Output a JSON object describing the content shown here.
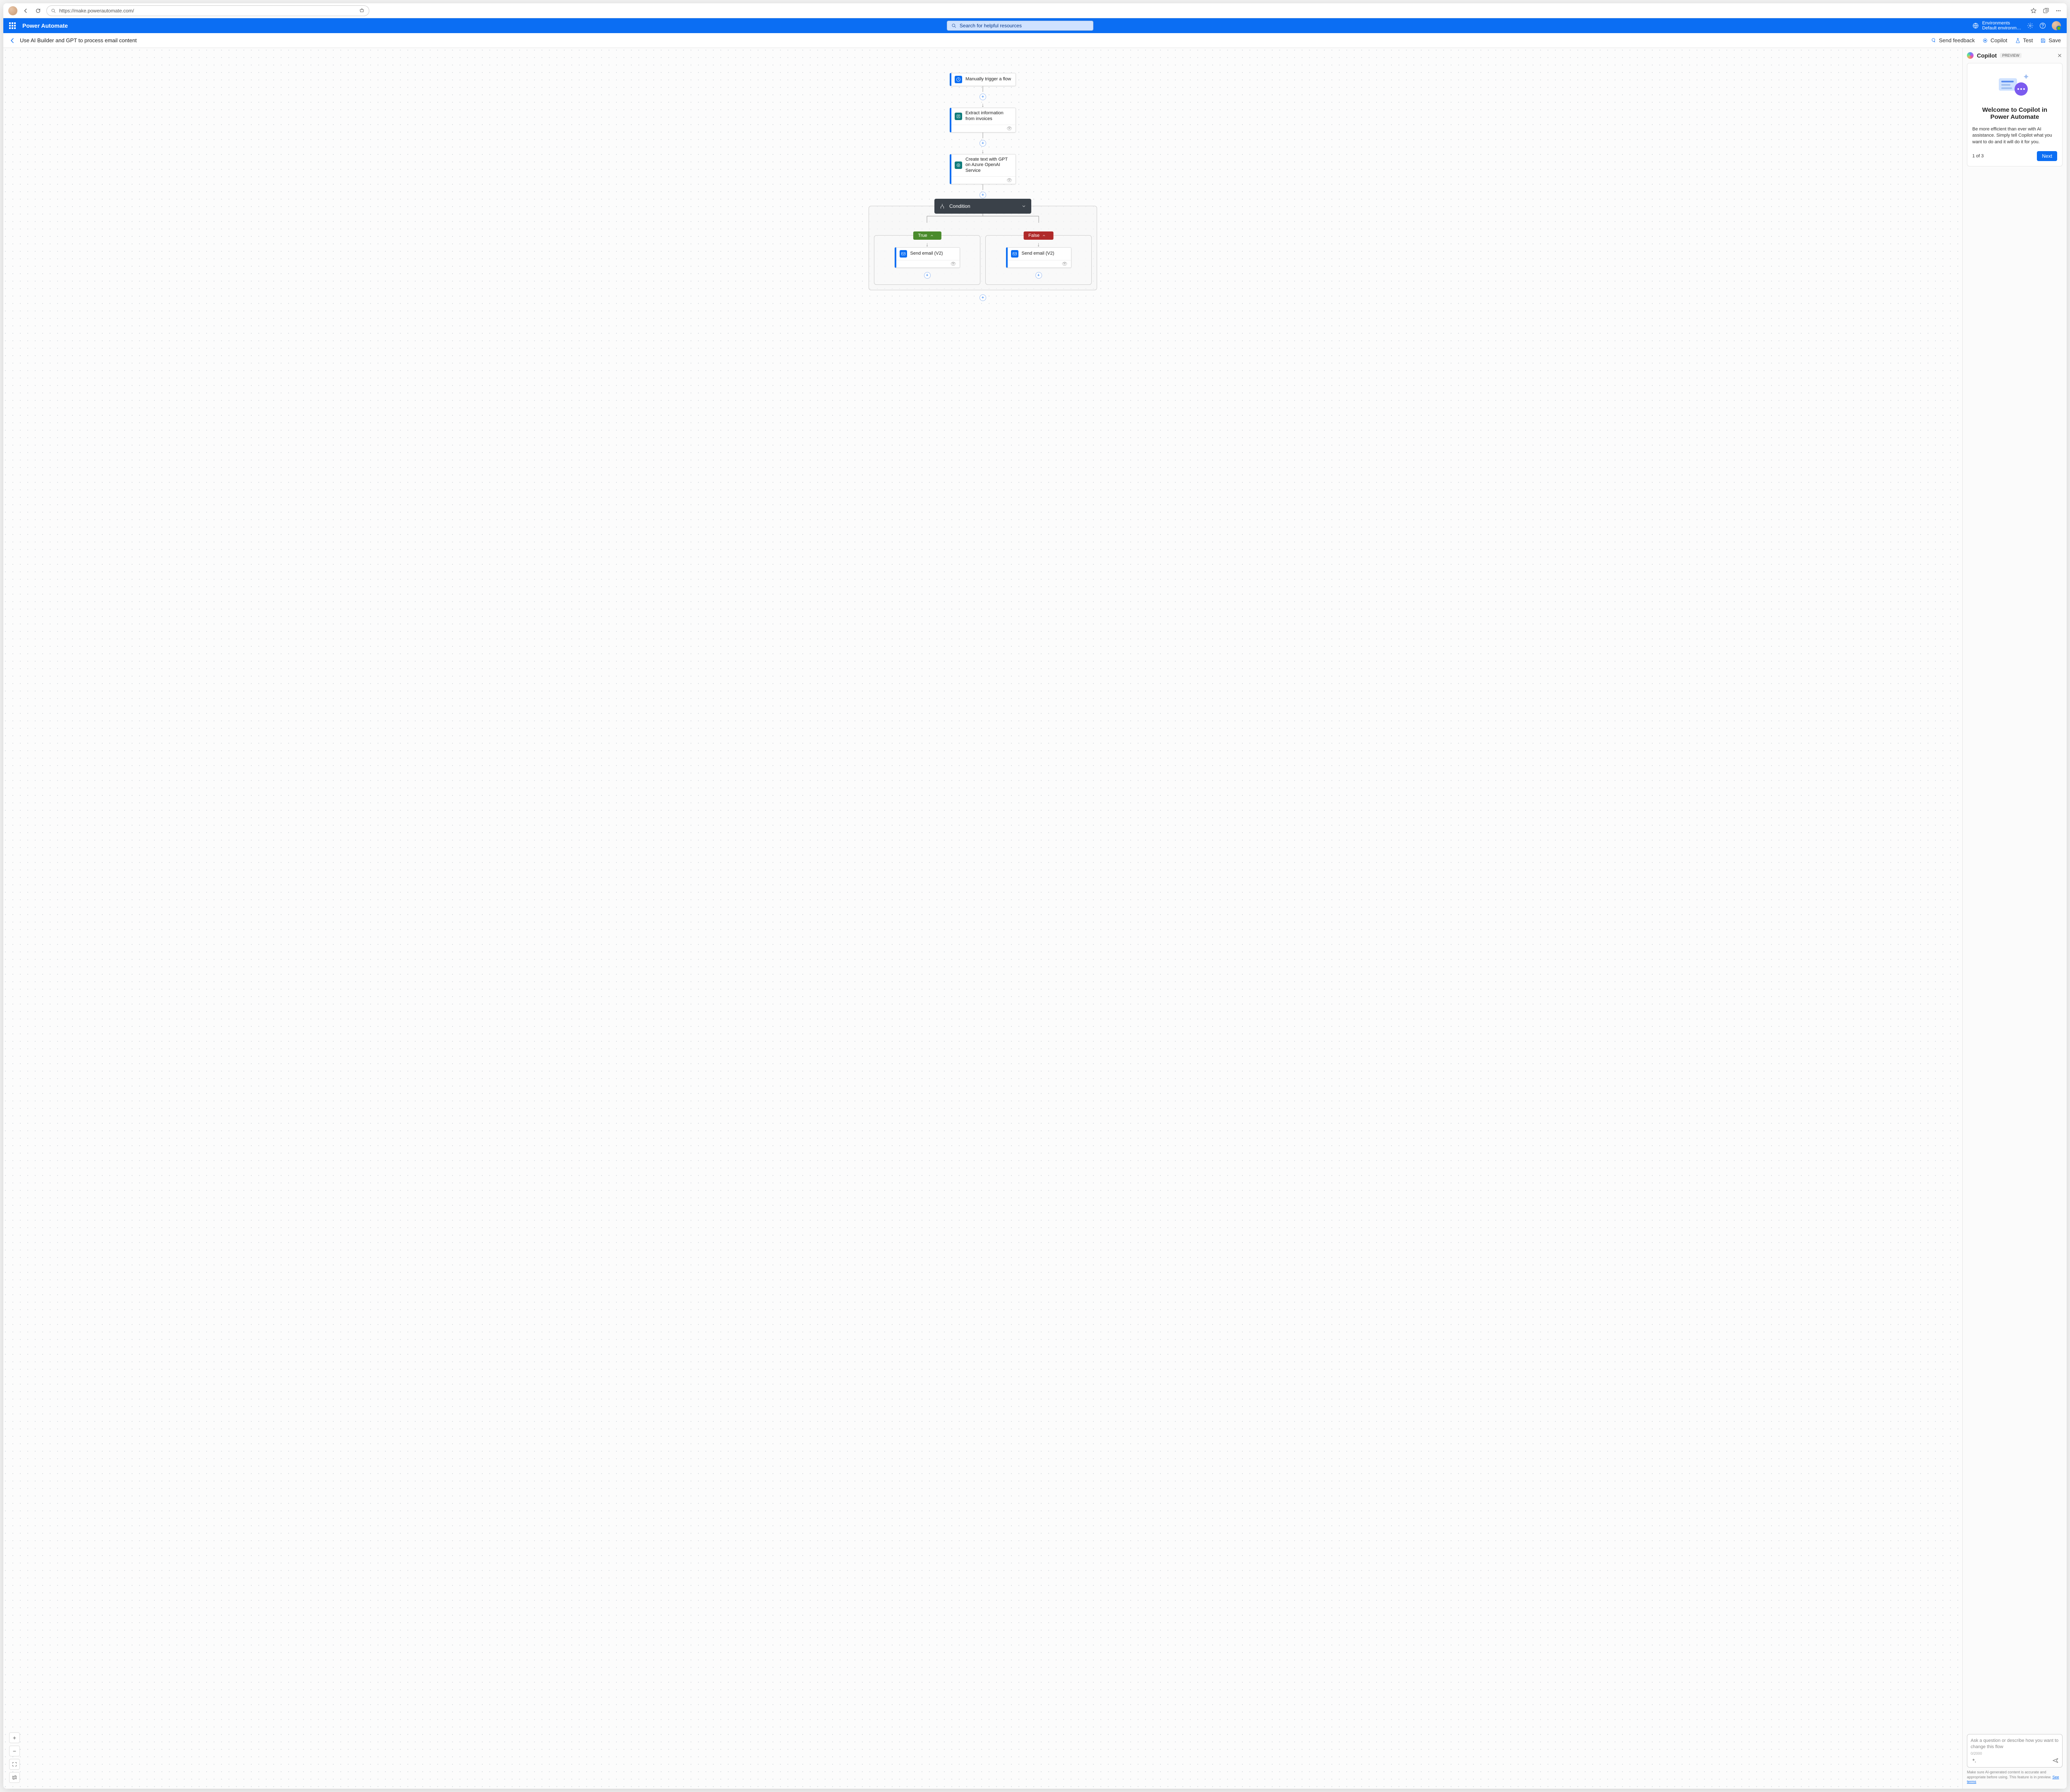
{
  "browser": {
    "url": "https://make.powerautomate.com/"
  },
  "header": {
    "app_name": "Power Automate",
    "search_placeholder": "Search for helpful resources",
    "env_label": "Environments",
    "env_value": "Default environm…"
  },
  "cmdbar": {
    "title": "Use AI Builder and GPT to process email content",
    "send_feedback": "Send feedback",
    "copilot": "Copilot",
    "test": "Test",
    "save": "Save"
  },
  "flow": {
    "n1": "Manually trigger a flow",
    "n2": "Extract information from invoices",
    "n3": "Create text with GPT on Azure OpenAI Service",
    "condition": "Condition",
    "true_label": "True",
    "false_label": "False",
    "send_email_true": "Send email (V2)",
    "send_email_false": "Send email (V2)"
  },
  "copilot": {
    "title": "Copilot",
    "preview": "PREVIEW",
    "welcome_title": "Welcome to Copilot in Power Automate",
    "welcome_body": "Be more efficient than ever with AI assistance. Simply tell Copilot what you want to do and it will do it for you.",
    "step": "1 of 3",
    "next": "Next",
    "input_placeholder": "Ask a question or describe how you want to change this flow",
    "counter": "0/2000",
    "disclaimer_a": "Make sure AI-generated content is accurate and appropriate before using. This feature is in preview. ",
    "disclaimer_link": "See terms"
  }
}
